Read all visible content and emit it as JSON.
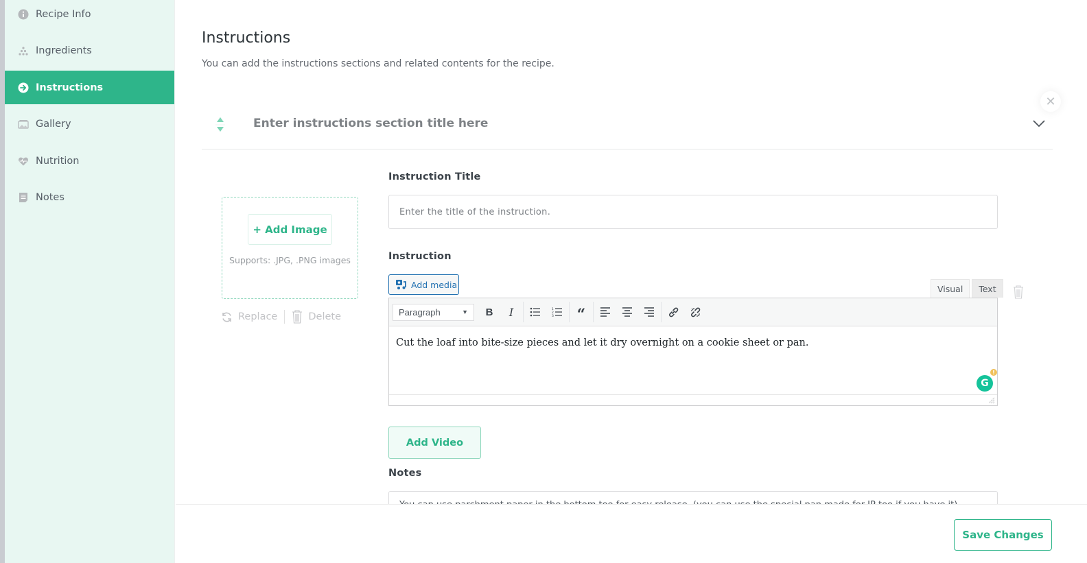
{
  "sidebar": {
    "items": [
      {
        "label": "Recipe Info",
        "icon": "info-circle-icon",
        "active": false
      },
      {
        "label": "Ingredients",
        "icon": "dots-pyramid-icon",
        "active": false
      },
      {
        "label": "Instructions",
        "icon": "arrow-circle-right-icon",
        "active": true
      },
      {
        "label": "Gallery",
        "icon": "image-icon",
        "active": false
      },
      {
        "label": "Nutrition",
        "icon": "heart-pulse-icon",
        "active": false
      },
      {
        "label": "Notes",
        "icon": "document-icon",
        "active": false
      }
    ]
  },
  "page": {
    "title": "Instructions",
    "subtitle": "You can add the instructions sections and related contents for the recipe."
  },
  "section": {
    "title_placeholder": "Enter instructions section title here",
    "title_value": ""
  },
  "image_upload": {
    "add_label": "+ Add Image",
    "supports_text": "Supports: .JPG, .PNG images",
    "replace_label": "Replace",
    "delete_label": "Delete"
  },
  "instruction_title": {
    "label": "Instruction Title",
    "placeholder": "Enter the title of the instruction.",
    "value": ""
  },
  "instruction": {
    "label": "Instruction",
    "add_media_label": "Add media",
    "tabs": [
      {
        "label": "Visual",
        "active": false
      },
      {
        "label": "Text",
        "active": true
      }
    ],
    "format_select": "Paragraph",
    "toolbar": [
      "bold",
      "italic",
      "bullet-list",
      "numbered-list",
      "blockquote",
      "align-left",
      "align-center",
      "align-right",
      "insert-link",
      "remove-link"
    ],
    "content": "Cut the loaf into bite-size pieces and let it dry overnight on a cookie sheet or pan."
  },
  "video": {
    "add_label": "Add Video"
  },
  "notes": {
    "label": "Notes",
    "value": "You can use parchment paper in the bottom too for easy release. (you can use the special pan made for IP too if you have it)"
  },
  "footer": {
    "save_label": "Save Changes"
  },
  "colors": {
    "accent": "#2eb58a",
    "sidebar_bg": "#e8f7f2",
    "wp_blue": "#2271b1"
  }
}
